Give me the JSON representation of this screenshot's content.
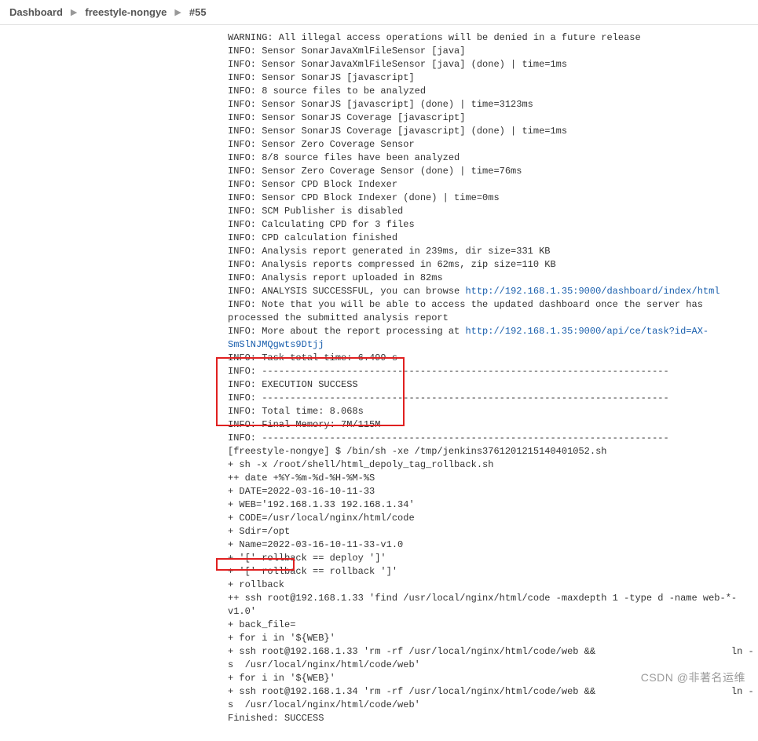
{
  "breadcrumb": {
    "dashboard": "Dashboard",
    "project": "freestyle-nongye",
    "build": "#55"
  },
  "console": {
    "l0": "WARNING: All illegal access operations will be denied in a future release",
    "l1": "INFO: Sensor SonarJavaXmlFileSensor [java]",
    "l2": "INFO: Sensor SonarJavaXmlFileSensor [java] (done) | time=1ms",
    "l3": "INFO: Sensor SonarJS [javascript]",
    "l4": "INFO: 8 source files to be analyzed",
    "l5": "INFO: Sensor SonarJS [javascript] (done) | time=3123ms",
    "l6": "INFO: Sensor SonarJS Coverage [javascript]",
    "l7": "INFO: Sensor SonarJS Coverage [javascript] (done) | time=1ms",
    "l8": "INFO: Sensor Zero Coverage Sensor",
    "l9": "INFO: 8/8 source files have been analyzed",
    "l10": "INFO: Sensor Zero Coverage Sensor (done) | time=76ms",
    "l11": "INFO: Sensor CPD Block Indexer",
    "l12": "INFO: Sensor CPD Block Indexer (done) | time=0ms",
    "l13": "INFO: SCM Publisher is disabled",
    "l14": "INFO: Calculating CPD for 3 files",
    "l15": "INFO: CPD calculation finished",
    "l16": "INFO: Analysis report generated in 239ms, dir size=331 KB",
    "l17": "INFO: Analysis reports compressed in 62ms, zip size=110 KB",
    "l18": "INFO: Analysis report uploaded in 82ms",
    "l19_pre": "INFO: ANALYSIS SUCCESSFUL, you can browse ",
    "l19_link": "http://192.168.1.35:9000/dashboard/index/html",
    "l20": "INFO: Note that you will be able to access the updated dashboard once the server has processed the submitted analysis report",
    "l21_pre": "INFO: More about the report processing at ",
    "l21_link": "http://192.168.1.35:9000/api/ce/task?id=AX-SmSlNJMQgwts9Dtjj",
    "l22": "INFO: Task total time: 6.499 s",
    "l23": "INFO: ------------------------------------------------------------------------",
    "l24": "INFO: EXECUTION SUCCESS",
    "l25": "INFO: ------------------------------------------------------------------------",
    "l26": "INFO: Total time: 8.068s",
    "l27": "INFO: Final Memory: 7M/115M",
    "l28": "INFO: ------------------------------------------------------------------------",
    "l29": "[freestyle-nongye] $ /bin/sh -xe /tmp/jenkins3761201215140401052.sh",
    "l30": "+ sh -x /root/shell/html_depoly_tag_rollback.sh",
    "l31": "++ date +%Y-%m-%d-%H-%M-%S",
    "l32": "+ DATE=2022-03-16-10-11-33",
    "l33": "+ WEB='192.168.1.33 192.168.1.34'",
    "l34": "+ CODE=/usr/local/nginx/html/code",
    "l35": "+ Sdir=/opt",
    "l36": "+ Name=2022-03-16-10-11-33-v1.0",
    "l37": "+ '[' rollback == deploy ']'",
    "l38": "+ '[' rollback == rollback ']'",
    "l39": "+ rollback",
    "l40": "++ ssh root@192.168.1.33 'find /usr/local/nginx/html/code -maxdepth 1 -type d -name web-*-v1.0'",
    "l41": "+ back_file=",
    "l42": "+ for i in '${WEB}'",
    "l43": "+ ssh root@192.168.1.33 'rm -rf /usr/local/nginx/html/code/web &&                        ln -s  /usr/local/nginx/html/code/web'",
    "l44": "+ for i in '${WEB}'",
    "l45": "+ ssh root@192.168.1.34 'rm -rf /usr/local/nginx/html/code/web &&                        ln -s  /usr/local/nginx/html/code/web'",
    "l46": "Finished: SUCCESS"
  },
  "watermark": "CSDN @非著名运维"
}
